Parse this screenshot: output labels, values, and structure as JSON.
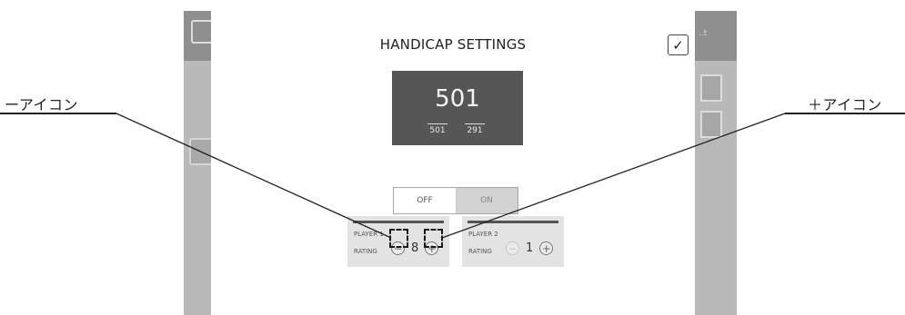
{
  "callouts": {
    "minus_label": "ーアイコン",
    "plus_label": "＋アイコン"
  },
  "app_background": {
    "right_text": "..t"
  },
  "dialog": {
    "title": "HANDICAP SETTINGS",
    "confirm_icon": "check-icon",
    "score": {
      "main": "501",
      "sub_values": [
        "501",
        "291"
      ]
    },
    "toggle": {
      "off_label": "OFF",
      "on_label": "ON",
      "selected": "ON"
    },
    "players": [
      {
        "name": "PLAYER 1",
        "rating_label": "RATING",
        "rating_value": "8",
        "minus_icon": "minus-circle-icon",
        "plus_icon": "plus-circle-icon"
      },
      {
        "name": "PLAYER 2",
        "rating_label": "RATING",
        "rating_value": "1",
        "minus_icon": "minus-circle-icon",
        "plus_icon": "plus-circle-icon"
      }
    ]
  },
  "colors": {
    "score_panel": "#565656",
    "backdrop": "#b9b9b9",
    "toggle_on": "#d2d2d2"
  }
}
